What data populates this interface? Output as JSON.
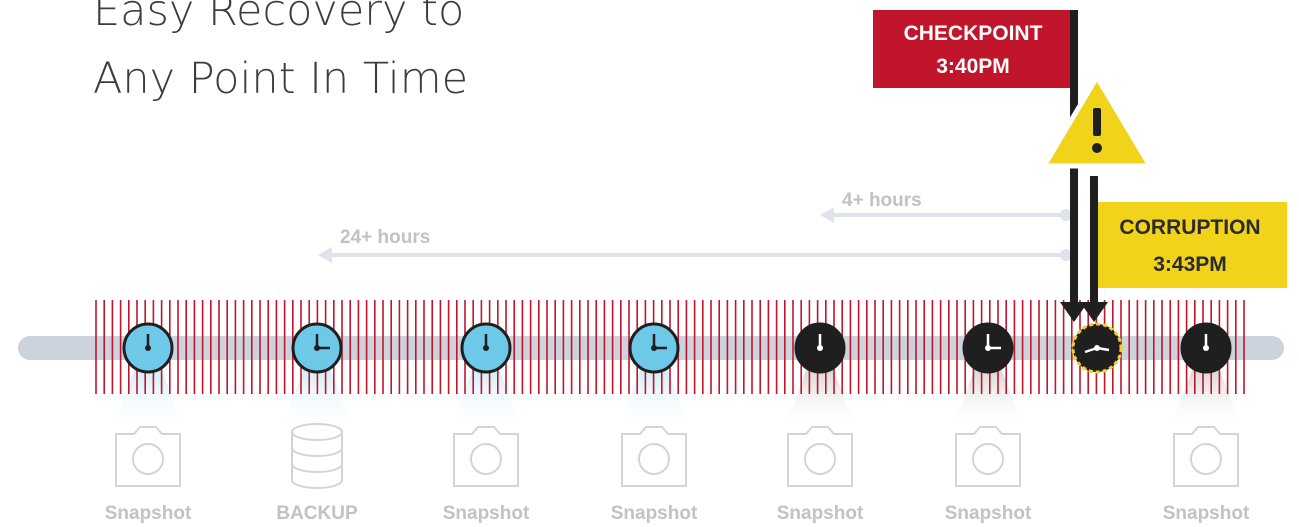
{
  "title": {
    "line1": "Easy Recovery to",
    "line2": "Any Point In Time"
  },
  "checkpoint": {
    "label": "CHECKPOINT",
    "time": "3:40PM",
    "color": "#c0152b"
  },
  "corruption": {
    "label": "CORRUPTION",
    "time": "3:43PM",
    "color": "#f2d31b"
  },
  "ranges": [
    {
      "label": "4+ hours"
    },
    {
      "label": "24+ hours"
    }
  ],
  "points": [
    {
      "label": "Snapshot",
      "kind": "snapshot",
      "state": "past",
      "icon": "camera-icon"
    },
    {
      "label": "BACKUP",
      "kind": "backup",
      "state": "past",
      "icon": "database-icon"
    },
    {
      "label": "Snapshot",
      "kind": "snapshot",
      "state": "past",
      "icon": "camera-icon"
    },
    {
      "label": "Snapshot",
      "kind": "snapshot",
      "state": "past",
      "icon": "camera-icon"
    },
    {
      "label": "Snapshot",
      "kind": "snapshot",
      "state": "recent",
      "icon": "camera-icon"
    },
    {
      "label": "Snapshot",
      "kind": "snapshot",
      "state": "recent",
      "icon": "camera-icon"
    },
    {
      "label": "",
      "kind": "corruption-point",
      "state": "corrupt",
      "icon": "clock-icon"
    },
    {
      "label": "Snapshot",
      "kind": "snapshot",
      "state": "recent",
      "icon": "camera-icon"
    }
  ],
  "colors": {
    "past_clock": "#6ec8e8",
    "recent_clock": "#1f1f1f",
    "tick": "#c0152b",
    "track": "#cdd3dc",
    "range_arrow": "#dfe4ea",
    "label_gray": "#c2c2c2"
  }
}
